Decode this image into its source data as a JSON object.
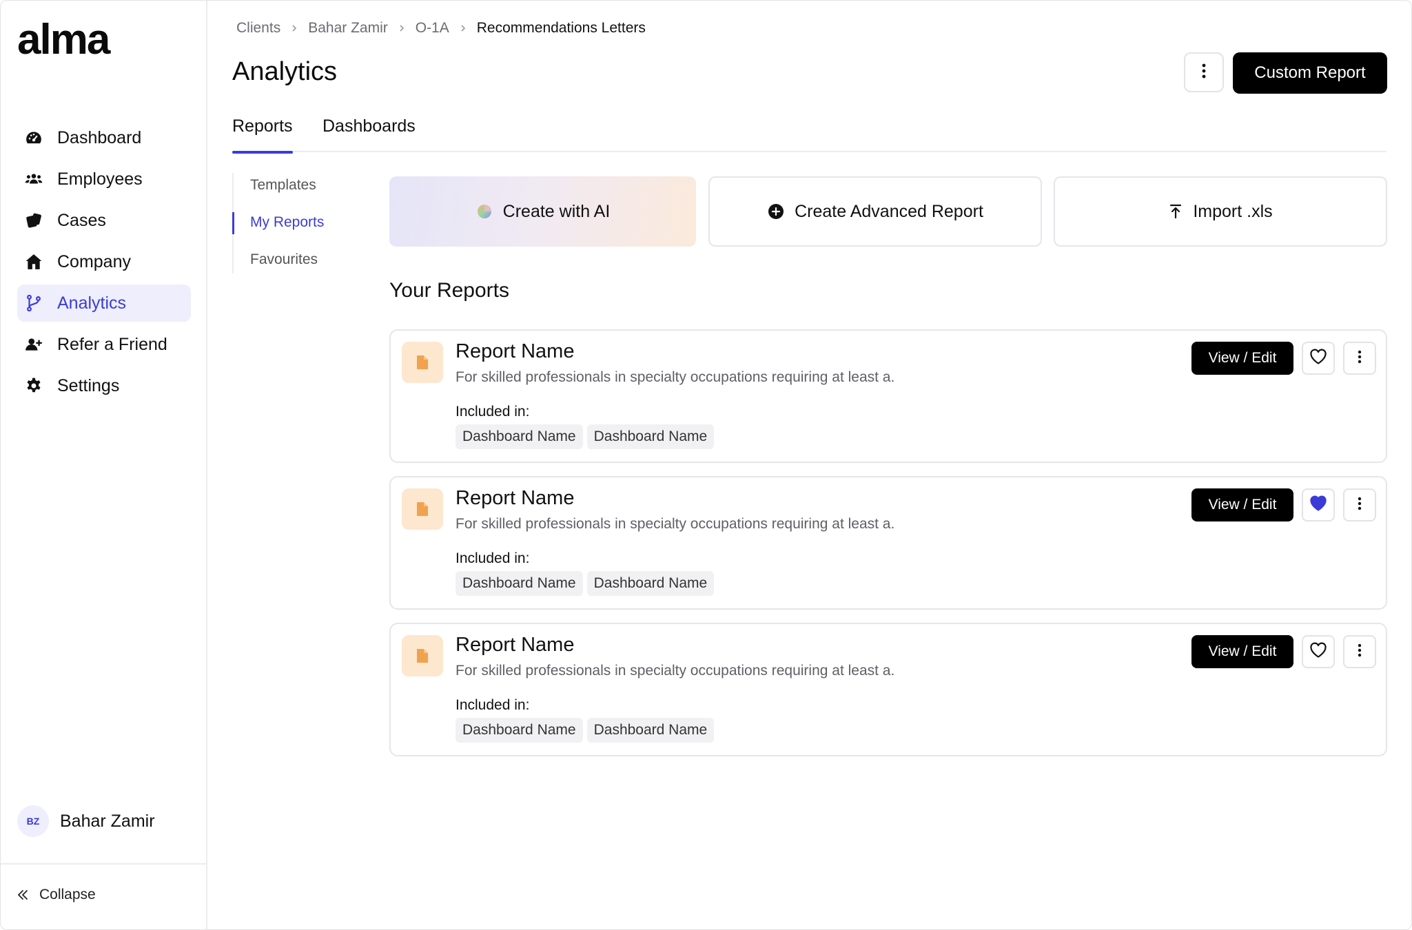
{
  "brand": {
    "logo_text": "alma",
    "accent_color": "#3b3bd8"
  },
  "sidebar": {
    "items": [
      {
        "label": "Dashboard",
        "icon": "dashboard-gauge-icon"
      },
      {
        "label": "Employees",
        "icon": "users-icon"
      },
      {
        "label": "Cases",
        "icon": "cases-icon"
      },
      {
        "label": "Company",
        "icon": "home-icon"
      },
      {
        "label": "Analytics",
        "icon": "branch-icon",
        "active": true
      },
      {
        "label": "Refer a Friend",
        "icon": "user-plus-icon"
      },
      {
        "label": "Settings",
        "icon": "gear-icon"
      }
    ],
    "user": {
      "initials": "BZ",
      "name": "Bahar Zamir"
    },
    "collapse_label": "Collapse"
  },
  "breadcrumb": [
    "Clients",
    "Bahar Zamir",
    "O-1A",
    "Recommendations Letters"
  ],
  "page": {
    "title": "Analytics",
    "custom_report_label": "Custom Report"
  },
  "tabs": [
    {
      "label": "Reports",
      "active": true
    },
    {
      "label": "Dashboards",
      "active": false
    }
  ],
  "subnav": [
    {
      "label": "Templates",
      "active": false
    },
    {
      "label": "My Reports",
      "active": true
    },
    {
      "label": "Favourites",
      "active": false
    }
  ],
  "actions": {
    "create_ai": "Create with AI",
    "create_advanced": "Create Advanced Report",
    "import_xls": "Import .xls"
  },
  "section_title": "Your Reports",
  "reports": [
    {
      "name": "Report Name",
      "description": "For skilled professionals in specialty occupations requiring at least a.",
      "included_label": "Included in:",
      "dashboards": [
        "Dashboard Name",
        "Dashboard Name"
      ],
      "view_label": "View / Edit",
      "favourite": false
    },
    {
      "name": "Report Name",
      "description": "For skilled professionals in specialty occupations requiring at least a.",
      "included_label": "Included in:",
      "dashboards": [
        "Dashboard Name",
        "Dashboard Name"
      ],
      "view_label": "View / Edit",
      "favourite": true
    },
    {
      "name": "Report Name",
      "description": "For skilled professionals in specialty occupations requiring at least a.",
      "included_label": "Included in:",
      "dashboards": [
        "Dashboard Name",
        "Dashboard Name"
      ],
      "view_label": "View / Edit",
      "favourite": false
    }
  ]
}
